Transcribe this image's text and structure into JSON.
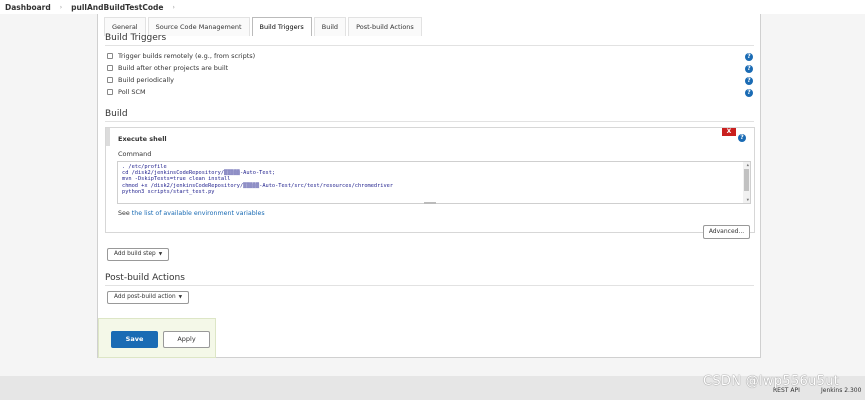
{
  "breadcrumb": {
    "dashboard": "Dashboard",
    "job": "pullAndBuildTestCode",
    "sep": "›"
  },
  "tabs": [
    "General",
    "Source Code Management",
    "Build Triggers",
    "Build",
    "Post-build Actions"
  ],
  "build_triggers": {
    "title": "Build Triggers",
    "options": [
      {
        "label": "Trigger builds remotely (e.g., from scripts)",
        "checked": false
      },
      {
        "label": "Build after other projects are built",
        "checked": false
      },
      {
        "label": "Build periodically",
        "checked": false
      },
      {
        "label": "Poll SCM",
        "checked": false
      }
    ]
  },
  "build": {
    "title": "Build",
    "step_title": "Execute shell",
    "delete_label": "X",
    "command_label": "Command",
    "command_lines": [
      ". /etc/profile",
      "cd /disk2/jenkinsCodeRepository/▒▒▒▒▒-Auto-Test;",
      "mvn -DskipTests=true clean install",
      "chmod +x /disk2/jenkinsCodeRepository/▒▒▒▒▒-Auto-Test/src/test/resources/chromedriver",
      "python3 scripts/start_test.py"
    ],
    "see_prefix": "See ",
    "envvars_link": "the list of available environment variables",
    "advanced_label": "Advanced...",
    "add_step_label": "Add build step"
  },
  "post_build": {
    "title": "Post-build Actions",
    "add_action_label": "Add post-build action"
  },
  "actions": {
    "save": "Save",
    "apply": "Apply"
  },
  "footer": {
    "rest_api": "REST API",
    "version": "Jenkins 2.300"
  },
  "watermark": "CSDN @lwp556u5ut",
  "colors": {
    "primary": "#1a6bb4",
    "danger": "#c9201f"
  }
}
